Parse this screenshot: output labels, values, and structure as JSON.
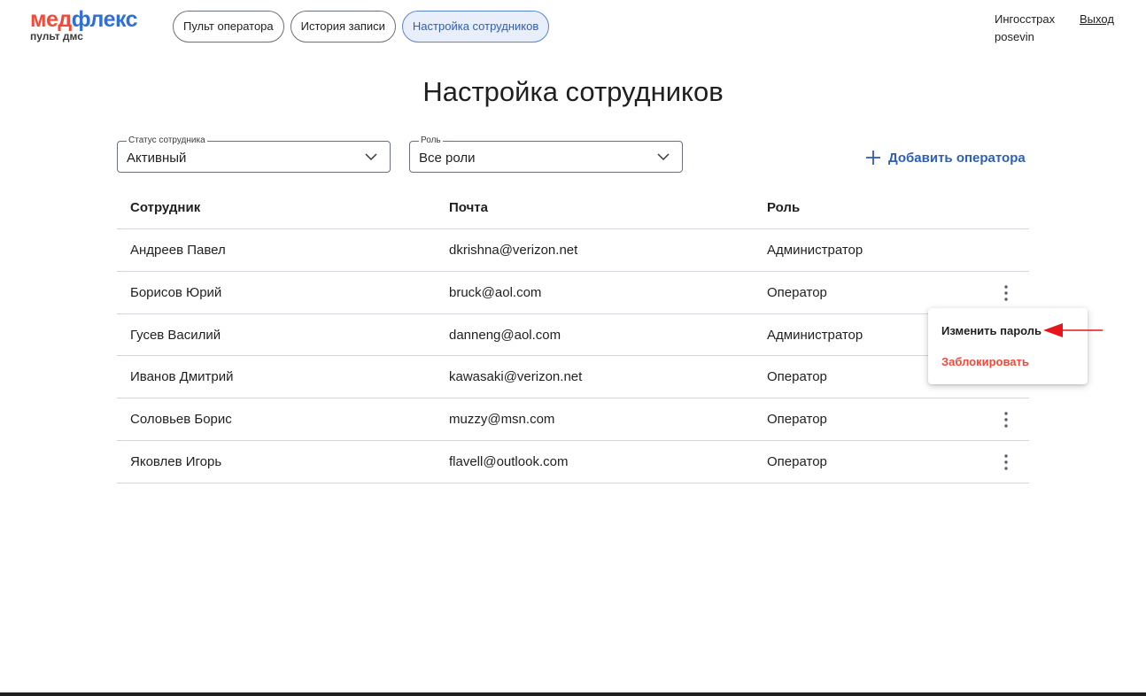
{
  "logo": {
    "part1": "мед",
    "part2": "флекс",
    "sub": "пульт дмс"
  },
  "nav": {
    "tabs": [
      {
        "label": "Пульт оператора",
        "active": false
      },
      {
        "label": "История записи",
        "active": false
      },
      {
        "label": "Настройка сотрудников",
        "active": true
      }
    ]
  },
  "user": {
    "company": "Ингосстрах",
    "login": "posevin",
    "logout_label": "Выход"
  },
  "page": {
    "title": "Настройка сотрудников"
  },
  "filters": {
    "status": {
      "legend": "Статус сотрудника",
      "value": "Активный"
    },
    "role": {
      "legend": "Роль",
      "value": "Все роли"
    }
  },
  "actions": {
    "add_operator": "Добавить оператора"
  },
  "table": {
    "headers": [
      "Сотрудник",
      "Почта",
      "Роль"
    ],
    "rows": [
      {
        "name": "Андреев Павел",
        "email": "dkrishna@verizon.net",
        "role": "Администратор",
        "has_menu": false
      },
      {
        "name": "Борисов Юрий",
        "email": "bruck@aol.com",
        "role": "Оператор",
        "has_menu": true
      },
      {
        "name": "Гусев Василий",
        "email": "danneng@aol.com",
        "role": "Администратор",
        "has_menu": false
      },
      {
        "name": "Иванов Дмитрий",
        "email": "kawasaki@verizon.net",
        "role": "Оператор",
        "has_menu": false
      },
      {
        "name": "Соловьев Борис",
        "email": "muzzy@msn.com",
        "role": "Оператор",
        "has_menu": true
      },
      {
        "name": "Яковлев Игорь",
        "email": "flavell@outlook.com",
        "role": "Оператор",
        "has_menu": true
      }
    ]
  },
  "menu": {
    "change_password": "Изменить пароль",
    "block": "Заблокировать"
  },
  "colors": {
    "brand_red": "#ef4a3b",
    "brand_blue": "#2f6fd6",
    "link_blue": "#2f5eb5",
    "active_tab_bg": "#e8effb",
    "arrow_red": "#e8141b"
  },
  "icons": {
    "chevron": "chevron-down-icon",
    "plus": "plus-icon",
    "kebab": "kebab-menu-icon",
    "arrow": "red-arrow-annotation"
  }
}
